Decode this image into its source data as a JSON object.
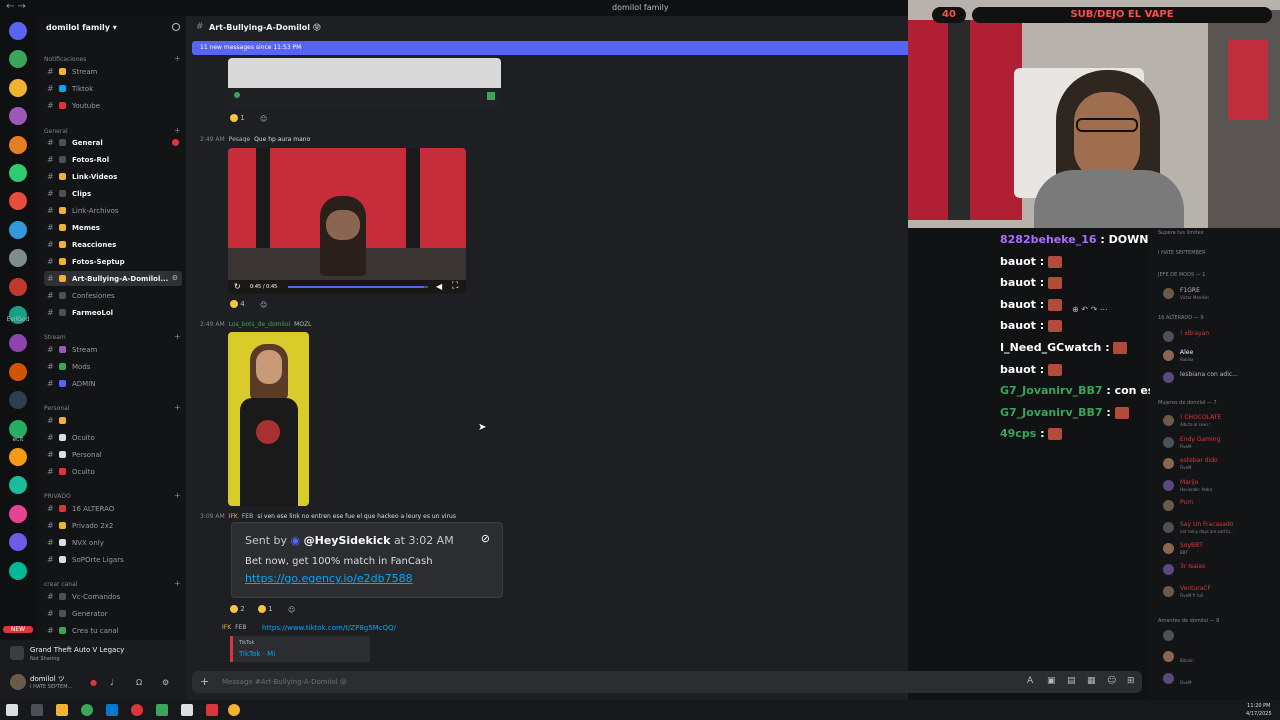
{
  "window": {
    "title": "domilol family"
  },
  "server": {
    "name": "domilol family ▾",
    "rail": [
      {
        "color": "#5865f2"
      },
      {
        "color": "#3ba55c"
      },
      {
        "color": "#f0b232"
      },
      {
        "color": "#9b59b6"
      },
      {
        "color": "#e67e22"
      },
      {
        "color": "#2ecc71"
      },
      {
        "color": "#e74c3c"
      },
      {
        "color": "#3498db"
      },
      {
        "color": "#7f8c8d"
      },
      {
        "color": "#c0392b"
      },
      {
        "color": "#16a085"
      },
      {
        "color": "#8e44ad"
      },
      {
        "color": "#d35400"
      },
      {
        "color": "#2c3e50"
      },
      {
        "color": "#27ae60"
      },
      {
        "color": "#f39c12"
      },
      {
        "color": "#1abc9c"
      },
      {
        "color": "#e84393"
      },
      {
        "color": "#6c5ce7"
      },
      {
        "color": "#00b894"
      }
    ],
    "rail_labels": {
      "evilgod": "EvilGod",
      "ecit": "ecit",
      "new": "NEW"
    }
  },
  "sidebar": {
    "categories": {
      "notificaciones": "Notificaciones",
      "general": "General",
      "stream": "Stream",
      "personal": "Personal",
      "privado": "PRIVADO",
      "crear_canal": "crear canal"
    },
    "notif_channels": [
      {
        "name": "Stream",
        "color": "#f0b232"
      },
      {
        "name": "Tiktok",
        "color": "#00a8fc"
      },
      {
        "name": "Youtube",
        "color": "#da373c"
      }
    ],
    "general_channels": [
      {
        "name": "General",
        "color": "#4e5058",
        "bright": true,
        "badge": true
      },
      {
        "name": "Fotos-Rol",
        "color": "#4e5058",
        "bright": true
      },
      {
        "name": "Link-Videos",
        "color": "#f0b232",
        "bright": true
      },
      {
        "name": "Clips",
        "color": "#4e5058",
        "bright": true
      },
      {
        "name": "Link-Archivos",
        "color": "#f0b232",
        "bright": false
      },
      {
        "name": "Memes",
        "color": "#f0b232",
        "bright": true
      },
      {
        "name": "Reacciones",
        "color": "#f0b232",
        "bright": true
      },
      {
        "name": "Fotos-Septup",
        "color": "#f0b232",
        "bright": true
      },
      {
        "name": "Art-Bullying-A-Domilol...",
        "color": "#f0b232",
        "bright": true,
        "active": true
      },
      {
        "name": "Confesiones",
        "color": "#4e5058",
        "bright": false
      },
      {
        "name": "FarmeoLol",
        "color": "#4e5058",
        "bright": true
      }
    ],
    "stream_channels": [
      {
        "name": "Stream",
        "color": "#9b59b6"
      },
      {
        "name": "Mods",
        "color": "#3ba55c"
      },
      {
        "name": "ADMIN",
        "color": "#5865f2"
      }
    ],
    "personal_channels": [
      {
        "name": "",
        "color": "#f0b232"
      },
      {
        "name": "Oculto",
        "color": "#dbdee1"
      },
      {
        "name": "Personal",
        "color": "#dbdee1"
      },
      {
        "name": "Oculto",
        "color": "#da373c"
      }
    ],
    "privado_channels": [
      {
        "name": "16 ALTERAO",
        "color": "#da373c"
      },
      {
        "name": "Privado 2x2",
        "color": "#f0b232"
      },
      {
        "name": "NVX only",
        "color": "#dbdee1"
      },
      {
        "name": "SoPOrte Ligars",
        "color": "#dbdee1"
      }
    ],
    "crear_channels": [
      {
        "name": "Vc-Comandos",
        "color": "#4e5058"
      },
      {
        "name": "Generator",
        "color": "#4e5058"
      },
      {
        "name": "Crea tu canal",
        "color": "#3ba55c"
      }
    ]
  },
  "activity": {
    "game": "Grand Theft Auto V Legacy",
    "sub": "Not Sharing"
  },
  "user": {
    "name": "domilol ツ",
    "status": "I HATE SEPTEM..."
  },
  "chat": {
    "channel_name": "Art-Bullying-A-Domilol 😝",
    "new_messages": "11 new messages since 11:53 PM",
    "reaction1": "1",
    "msg2_time": "2:49 AM",
    "msg2_author": "Pesaqe",
    "msg2_text": "Que hp aura mano",
    "video_time": "0:45 / 0:45",
    "video_progress": 0.97,
    "reaction2": "4",
    "msg3_time": "2:49 AM",
    "msg3_author": "Los_bots_de_domilol",
    "msg3_tag": "MOZL",
    "msg4_time": "3:09 AM",
    "msg4_author": "IFK",
    "msg4_tag": "FEB",
    "msg4_text": "si ven ese link no entren ese fue el que hackeo a leury es un virus",
    "sidekick_prefix": "Sent by",
    "sidekick_handle": "@HeySidekick",
    "sidekick_at": "at 3:02 AM",
    "sidekick_body": "Bet now, get 100% match in FanCash",
    "sidekick_link": "https://go.egency.io/e2db7588",
    "reaction3a": "2",
    "reaction3b": "1",
    "msg5_author": "IFK",
    "msg5_tag": "FEB",
    "msg5_link": "https://www.tiktok.com/t/ZP8g5McQQ/",
    "tiktok_site": "TikTok",
    "tiktok_title": "TikTok · Mi",
    "composer_placeholder": "Message #Art-Bullying-A-Domilol 😝"
  },
  "overlay": {
    "count": "40",
    "banner": "SUB/DEJO EL VAPE"
  },
  "stream_chat": [
    {
      "user": "8282beheke_16",
      "color": "#a970ff",
      "msg": "DOWN",
      "emote": false
    },
    {
      "user": "bauot",
      "color": "#ffffff",
      "msg": "",
      "emote": true
    },
    {
      "user": "bauot",
      "color": "#ffffff",
      "msg": "",
      "emote": true
    },
    {
      "user": "bauot",
      "color": "#ffffff",
      "msg": "",
      "emote": true
    },
    {
      "user": "bauot",
      "color": "#ffffff",
      "msg": "",
      "emote": true
    },
    {
      "user": "I_Need_GCwatch",
      "color": "#ffffff",
      "msg": "",
      "emote": true
    },
    {
      "user": "bauot",
      "color": "#ffffff",
      "msg": "",
      "emote": true
    },
    {
      "user": "G7_Jovanirv_BB7",
      "color": "#3ba55c",
      "msg": "con ese mismo cuchillo le van a c",
      "emote": false
    },
    {
      "user": "G7_Jovanirv_BB7",
      "color": "#3ba55c",
      "msg": "",
      "emote": true
    },
    {
      "user": "49cps",
      "color": "#3ba55c",
      "msg": "",
      "emote": true
    }
  ],
  "members": {
    "top_status": "Supera tus limites",
    "top_status2": "I HATE SEPTEMBER",
    "jefe": "JEFE DE MODS — 1",
    "alterado": "16 ALTERADO — 9",
    "mujeres": "Mujeres de domilol — 7",
    "amantes": "Amantes de domilol — 9",
    "list": [
      {
        "name": "F1GRE",
        "color": "#b5bac1",
        "sub": "Victor Mendiel"
      },
      {
        "name": "! xBrayan",
        "color": "#da373c",
        "sub": ""
      },
      {
        "name": "Alee",
        "color": "#f2f3f5",
        "sub": "Roblox"
      },
      {
        "name": "lesbiana con adic...",
        "color": "#b5bac1",
        "sub": ""
      },
      {
        "name": "! CHOCOLATE",
        "color": "#da373c",
        "sub": "Adicta al sexo !"
      },
      {
        "name": "Endy Gaming",
        "color": "#da373c",
        "sub": "FiveM"
      },
      {
        "name": "estebar dido",
        "color": "#da373c",
        "sub": "FiveM"
      },
      {
        "name": "Marijo",
        "color": "#da373c",
        "sub": "Haciendo: Yedro"
      },
      {
        "name": "Pum",
        "color": "#da373c",
        "sub": ""
      },
      {
        "name": "Say Un Fracasado",
        "color": "#da373c",
        "sub": "not rainy days are sad fu..."
      },
      {
        "name": "SoyBBT",
        "color": "#da373c",
        "sub": "BBT"
      },
      {
        "name": "3r Isaias",
        "color": "#da373c",
        "sub": ""
      },
      {
        "name": "VenturaCF",
        "color": "#da373c",
        "sub": "FiveM fr full"
      },
      {
        "name": "",
        "color": "#da373c",
        "sub": ""
      },
      {
        "name": "",
        "color": "#da373c",
        "sub": "Bitcoin"
      },
      {
        "name": "",
        "color": "#da373c",
        "sub": "FiveM"
      }
    ]
  },
  "taskbar": {
    "time": "11:20 PM",
    "date": "4/17/2025"
  }
}
